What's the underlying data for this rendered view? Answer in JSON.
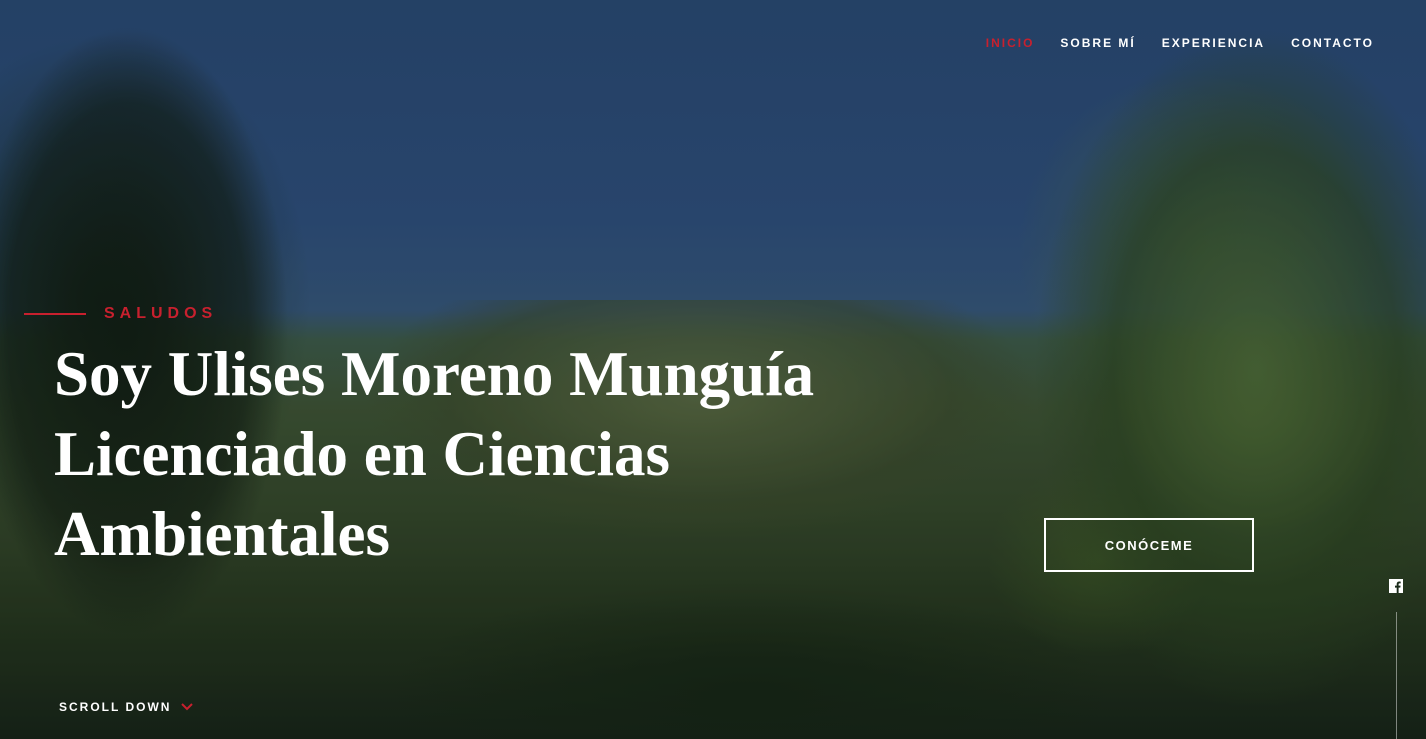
{
  "nav": {
    "items": [
      {
        "label": "INICIO",
        "active": true
      },
      {
        "label": "SOBRE MÍ",
        "active": false
      },
      {
        "label": "EXPERIENCIA",
        "active": false
      },
      {
        "label": "CONTACTO",
        "active": false
      }
    ]
  },
  "hero": {
    "greeting": "SALUDOS",
    "headline_lines": [
      "Soy Ulises Moreno Munguía",
      "Licenciado en Ciencias",
      "Ambientales"
    ],
    "cta_label": "CONÓCEME",
    "scroll_label": "SCROLL DOWN"
  },
  "social": {
    "icon": "facebook-icon"
  },
  "colors": {
    "accent": "#c8202e",
    "text": "#ffffff"
  }
}
